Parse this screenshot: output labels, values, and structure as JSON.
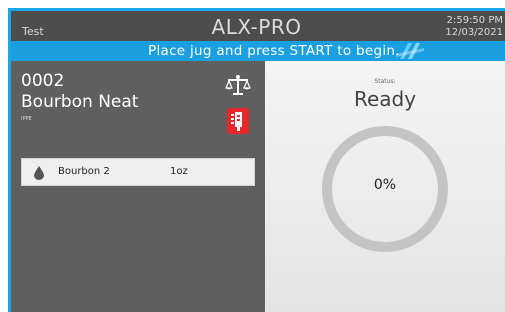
{
  "header": {
    "left_label": "Test",
    "title": "ALX-PRO",
    "time": "2:59:50 PM",
    "date": "12/03/2021"
  },
  "banner": {
    "message": "Place jug and press START to begin."
  },
  "drink": {
    "code": "0002",
    "name": "Bourbon Neat",
    "sub_label": "IPPE",
    "ingredients": [
      {
        "name": "Bourbon 2",
        "amount": "1oz",
        "icon": "drop-icon"
      }
    ]
  },
  "status": {
    "label": "Status:",
    "value": "Ready",
    "progress_text": "0%",
    "progress": 0
  },
  "icons": {
    "scale": "scale-icon",
    "pour_gun": "pour-gun-icon"
  },
  "colors": {
    "accent": "#1aa7e6",
    "banner": "#1a9fe0",
    "panel_dark": "#5f5f5f",
    "titlebar": "#4d4d4d",
    "pour_button": "#e8272a",
    "ring": "#c4c4c4"
  }
}
